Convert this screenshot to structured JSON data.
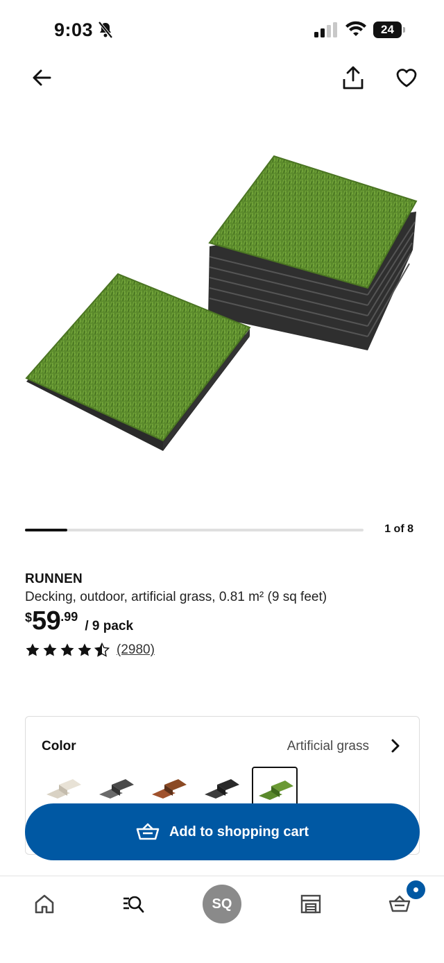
{
  "status_bar": {
    "time": "9:03",
    "battery": "24",
    "icons": [
      "bell-slash-icon",
      "signal-icon",
      "wifi-icon",
      "battery-icon"
    ]
  },
  "nav": {
    "icons": [
      "back-arrow-icon",
      "share-icon",
      "heart-icon"
    ]
  },
  "carousel": {
    "counter": "1 of 8",
    "progress": 0.125
  },
  "product": {
    "name": "RUNNEN",
    "description": "Decking, outdoor, artificial grass, 0.81 m² (9 sq feet)",
    "price": {
      "currency": "$",
      "integer": "59",
      "decimal": ".99",
      "unit": "/ 9 pack"
    },
    "rating": {
      "value": 4.5,
      "max": 5,
      "review_count": "(2980)"
    }
  },
  "color_selector": {
    "label": "Color",
    "selected": "Artificial grass",
    "swatches": [
      "beige-tiles",
      "gray-tiles",
      "brown-tiles",
      "dark-gray-tiles",
      "artificial-grass-tiles"
    ],
    "selected_index": 4
  },
  "cart_button": {
    "label": "Add to shopping cart"
  },
  "bottom_nav": {
    "profile_initials": "SQ",
    "icons": [
      "home-icon",
      "search-list-icon",
      "profile-avatar",
      "store-icon",
      "cart-icon"
    ],
    "cart_badge": true
  },
  "colors": {
    "brand_blue": "#0058a3",
    "grass": "#5b8a2c",
    "avatar_gray": "#8a8a8a"
  }
}
